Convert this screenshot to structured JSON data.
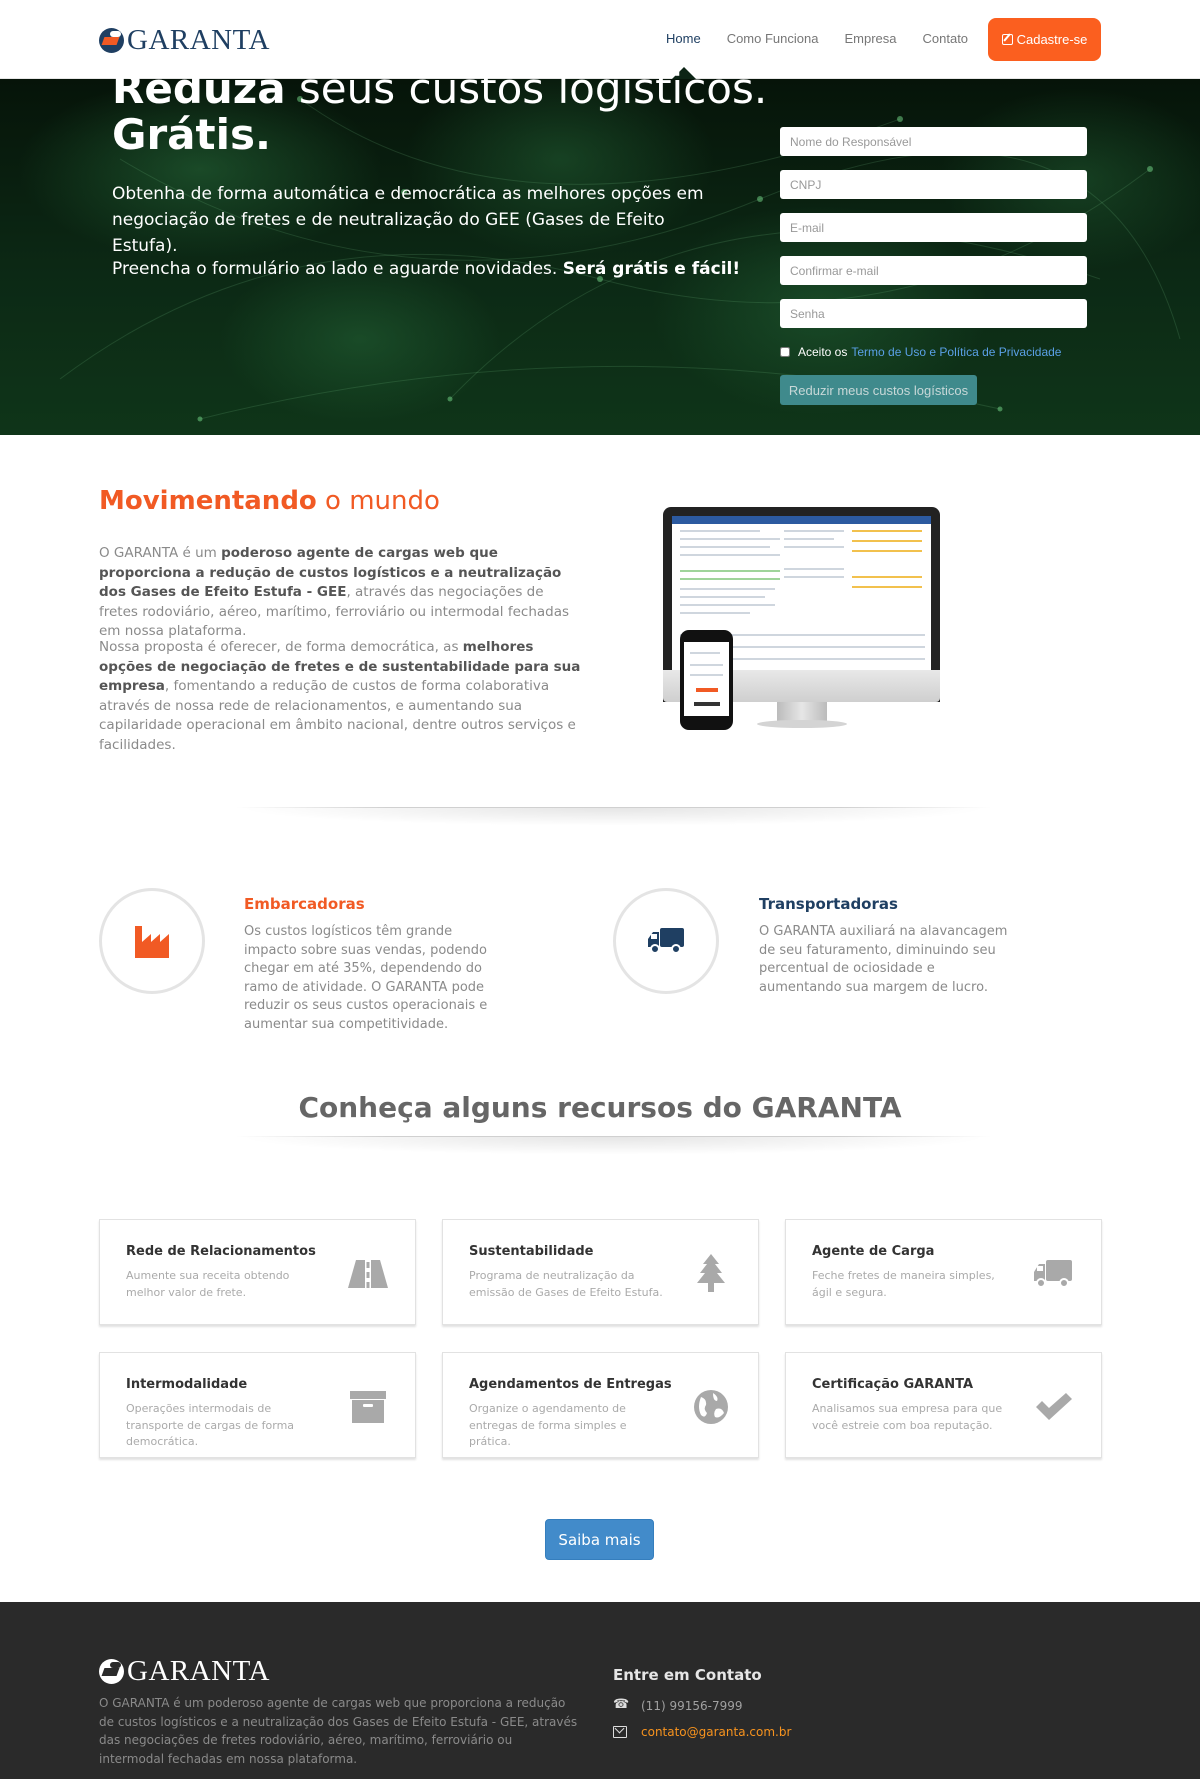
{
  "brand": {
    "name": "GARANTA"
  },
  "nav": {
    "links": [
      "Home",
      "Como Funciona",
      "Empresa",
      "Contato"
    ],
    "active": "Home",
    "cta_label": "Cadastre-se"
  },
  "hero": {
    "title_bold": "Reduza",
    "title_rest": " seus custos logísticos.",
    "title_line2": "Grátis.",
    "text": "Obtenha de forma automática e democrática as melhores opções em negociação de fretes e de neutralização do GEE (Gases de Efeito Estufa).",
    "text2": "Preencha o formulário ao lado e aguarde novidades. ",
    "text2_bold": "Será grátis e fácil!"
  },
  "signup_form": {
    "name_placeholder": "Nome do Responsável",
    "cnpj_placeholder": "CNPJ",
    "email_placeholder": "E-mail",
    "confirm_email_placeholder": "Confirmar e-mail",
    "password_placeholder": "Senha",
    "terms_prefix": "Aceito os",
    "terms_link": "Termo de Uso e Política de Privacidade",
    "submit_label": "Reduzir meus custos logísticos"
  },
  "about": {
    "title_bold": "Movimentando",
    "title_light": " o mundo",
    "p1_a": "O GARANTA é um ",
    "p1_b": "poderoso agente de cargas web que proporciona a redução de custos logísticos e a neutralização dos Gases de Efeito Estufa - GEE",
    "p1_c": ", através das negociações de fretes rodoviário, aéreo, marítimo, ferroviário ou intermodal fechadas em nossa plataforma.",
    "p2_a": "Nossa proposta é oferecer, de forma democrática, as ",
    "p2_b": "melhores opções de negociação de fretes e de sustentabilidade para sua empresa",
    "p2_c": ", fomentando a redução de custos de forma colaborativa através de nossa rede de relacionamentos, e aumentando sua capilaridade operacional em âmbito nacional, dentre outros serviços e facilidades."
  },
  "audiences": [
    {
      "title": "Embarcadoras",
      "color": "#f15a24",
      "icon": "factory-icon",
      "text": "Os custos logísticos têm grande impacto sobre suas vendas, podendo chegar em até 35%, dependendo do ramo de atividade. O GARANTA pode reduzir os seus custos operacionais e aumentar sua competitividade."
    },
    {
      "title": "Transportadoras",
      "color": "#1f3f62",
      "icon": "truck-icon",
      "text": "O GARANTA auxiliará na alavancagem de seu faturamento, diminuindo seu percentual de ociosidade e aumentando sua margem de lucro."
    }
  ],
  "features_title": "Conheça alguns recursos do GARANTA",
  "features": [
    {
      "title": "Rede de Relacionamentos",
      "text": "Aumente sua receita obtendo melhor valor de frete.",
      "icon": "road-icon"
    },
    {
      "title": "Sustentabilidade",
      "text": "Programa de neutralização da emissão de Gases de Efeito Estufa.",
      "icon": "tree-icon"
    },
    {
      "title": "Agente de Carga",
      "text": "Feche fretes de maneira simples, ágil e segura.",
      "icon": "truck-icon"
    },
    {
      "title": "Intermodalidade",
      "text": "Operações intermodais de transporte de cargas de forma democrática.",
      "icon": "archive-icon"
    },
    {
      "title": "Agendamentos de Entregas",
      "text": "Organize o agendamento de entregas de forma simples e prática.",
      "icon": "globe-icon"
    },
    {
      "title": "Certificação GARANTA",
      "text": "Analisamos sua empresa para que você estreie com boa reputação.",
      "icon": "check-icon"
    }
  ],
  "saiba_mais_label": "Saiba mais",
  "footer": {
    "text": "O GARANTA é um poderoso agente de cargas web que proporciona a redução de custos logísticos e a neutralização dos Gases de Efeito Estufa - GEE, através das negociações de fretes rodoviário, aéreo, marítimo, ferroviário ou intermodal fechadas em nossa plataforma.",
    "contact_title": "Entre em Contato",
    "phone": "(11) 99156-7999",
    "email": "contato@garanta.com.br"
  },
  "colors": {
    "accent": "#fb5f1f",
    "brand": "#1f3f62",
    "hero_bg": "#0c2915",
    "footer_bg": "#2a2a2a",
    "link": "#428bca"
  }
}
